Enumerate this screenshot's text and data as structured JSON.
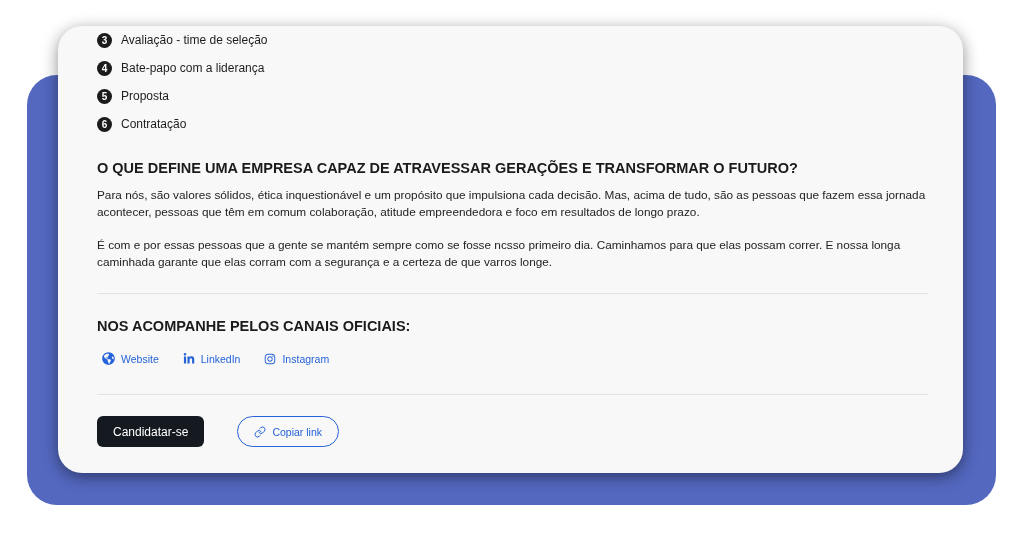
{
  "steps": [
    {
      "number": "3",
      "label": "Avaliação - time de seleção"
    },
    {
      "number": "4",
      "label": "Bate-papo com a liderança"
    },
    {
      "number": "5",
      "label": "Proposta"
    },
    {
      "number": "6",
      "label": "Contratação"
    }
  ],
  "heading": "O QUE DEFINE UMA EMPRESA CAPAZ DE ATRAVESSAR GERAÇÕES E TRANSFORMAR O FUTURO?",
  "paragraphs": [
    "Para nós, são valores sólidos, ética inquestionável e um propósito que impulsiona cada decisão. Mas, acima de tudo, são as pessoas que fazem essa jornada acontecer, pessoas que têm em comum colaboração, atitude empreendedora e foco em resultados de longo prazo.",
    "É com e por essas pessoas que a gente se mantém sempre como se fosse ncsso primeiro dia. Caminhamos para que elas possam correr. E nossa longa caminhada garante que elas corram com a segurança e a certeza de que varros longe."
  ],
  "channels_heading": "NOS ACOMPANHE PELOS CANAIS OFICIAIS:",
  "channels": [
    {
      "kind": "website",
      "label": "Website"
    },
    {
      "kind": "linkedin",
      "label": "LinkedIn"
    },
    {
      "kind": "instagram",
      "label": "Instagram"
    }
  ],
  "buttons": [
    {
      "kind": "primary",
      "label": "Candidatar-se"
    },
    {
      "kind": "outline",
      "label": "Copiar link"
    }
  ]
}
